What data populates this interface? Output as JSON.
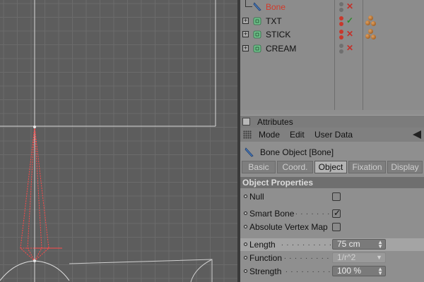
{
  "object_manager": {
    "objects": [
      {
        "name": "Bone",
        "color": "#d23a2a",
        "selected": true
      },
      {
        "name": "TXT",
        "color": "#111111",
        "expandable": true
      },
      {
        "name": "STICK",
        "color": "#111111",
        "expandable": true
      },
      {
        "name": "CREAM",
        "color": "#111111",
        "expandable": true
      }
    ]
  },
  "attributes": {
    "title": "Attributes",
    "menu": {
      "mode": "Mode",
      "edit": "Edit",
      "user_data": "User Data"
    },
    "object_title": "Bone Object [Bone]",
    "tabs": [
      "Basic",
      "Coord.",
      "Object",
      "Fixation",
      "Display"
    ],
    "active_tab": "Object",
    "section_title": "Object Properties",
    "props": {
      "null": {
        "label": "Null",
        "checked": false
      },
      "smart_bone": {
        "label": "Smart Bone",
        "checked": true
      },
      "absolute_vertex_map": {
        "label": "Absolute Vertex Map",
        "checked": false
      },
      "length": {
        "label": "Length",
        "value": "75 cm"
      },
      "function": {
        "label": "Function",
        "value": "1/r^2"
      },
      "strength": {
        "label": "Strength",
        "value": "100 %"
      }
    }
  },
  "colors": {
    "viewport_bg": "#5d5d5d",
    "grid": "#6b6b6b",
    "bone": "#ff4a4a",
    "panel_bg": "#8f8f8f"
  }
}
